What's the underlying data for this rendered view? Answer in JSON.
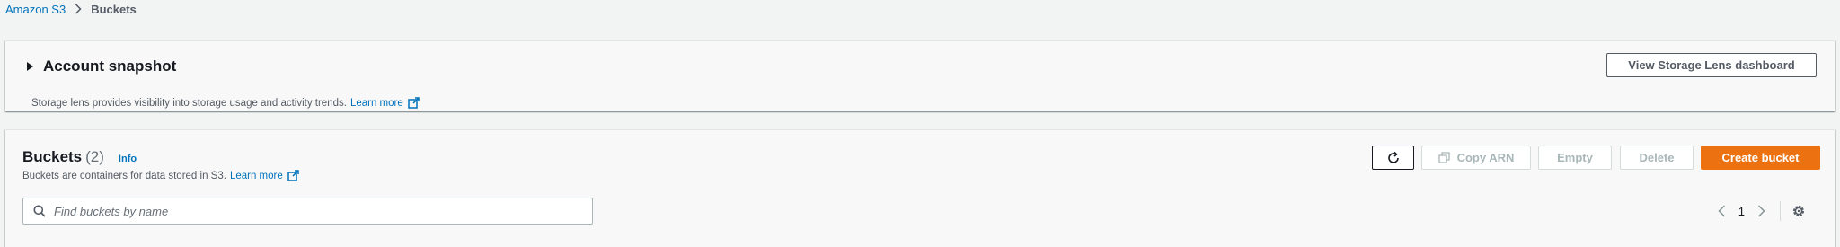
{
  "breadcrumb": {
    "root": "Amazon S3",
    "current": "Buckets"
  },
  "snapshot": {
    "title": "Account snapshot",
    "description": "Storage lens provides visibility into storage usage and activity trends.",
    "learn_more": "Learn more",
    "dashboard_button": "View Storage Lens dashboard"
  },
  "buckets": {
    "title": "Buckets",
    "count": "(2)",
    "info": "Info",
    "description": "Buckets are containers for data stored in S3.",
    "learn_more": "Learn more",
    "actions": {
      "copy_arn": "Copy ARN",
      "empty": "Empty",
      "delete": "Delete",
      "create": "Create bucket"
    },
    "search_placeholder": "Find buckets by name",
    "page": "1"
  },
  "colors": {
    "link": "#0073bb",
    "primary": "#ec7211"
  }
}
